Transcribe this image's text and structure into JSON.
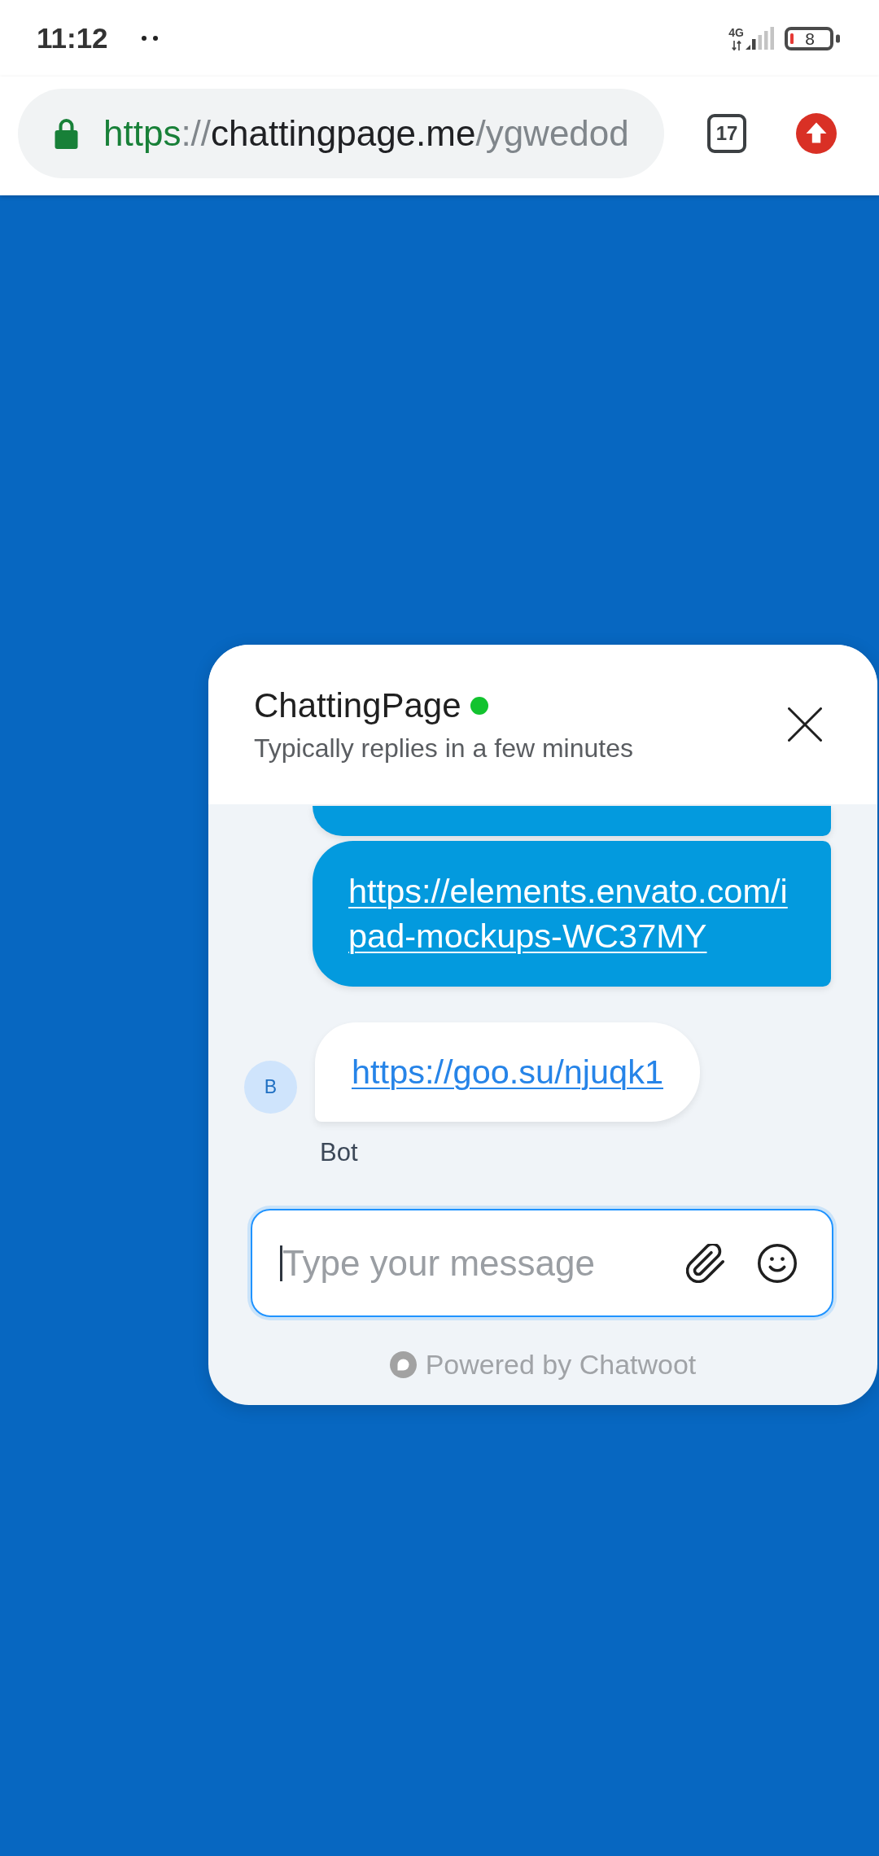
{
  "status_bar": {
    "time": "11:12",
    "network": "4G",
    "battery": "8"
  },
  "browser": {
    "url": {
      "scheme": "https",
      "separator": "://",
      "host": "chattingpage.me",
      "path": "/ygwedod"
    },
    "tab_count": "17"
  },
  "chat": {
    "title": "ChattingPage",
    "online": true,
    "subtitle": "Typically replies in a few minutes",
    "messages": [
      {
        "kind": "outgoing",
        "clipped": true
      },
      {
        "kind": "outgoing",
        "clipped": false,
        "text": "https://elements.envato.com/ipad-mockups-WC37MY"
      },
      {
        "kind": "incoming",
        "clipped": false,
        "avatar": "B",
        "text": "https://goo.su/njuqk1",
        "sender": "Bot"
      }
    ],
    "input": {
      "placeholder": "Type your message",
      "focused": true
    },
    "footer": "Powered by Chatwoot"
  }
}
